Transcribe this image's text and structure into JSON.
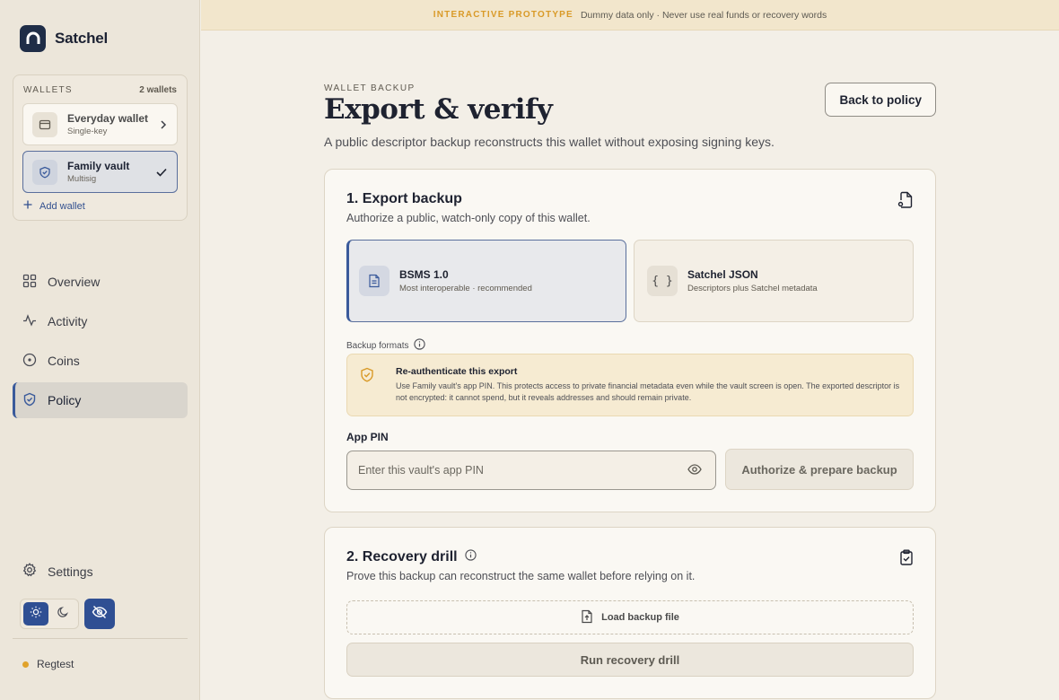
{
  "banner": {
    "tag": "INTERACTIVE PROTOTYPE",
    "text": "Dummy data only · Never use real funds or recovery words"
  },
  "brand": {
    "name": "Satchel",
    "logo_icon": "satchel-logo-icon"
  },
  "wallets": {
    "title": "WALLETS",
    "count": "2 wallets",
    "items": [
      {
        "name": "Everyday wallet",
        "type": "Single-key",
        "icon": "wallet-icon",
        "selected": false
      },
      {
        "name": "Family vault",
        "type": "Multisig",
        "icon": "shield-icon",
        "selected": true
      }
    ],
    "add_label": "Add wallet"
  },
  "nav": {
    "items": [
      {
        "label": "Overview",
        "icon": "grid-icon",
        "active": false
      },
      {
        "label": "Activity",
        "icon": "activity-icon",
        "active": false
      },
      {
        "label": "Coins",
        "icon": "coin-icon",
        "active": false
      },
      {
        "label": "Policy",
        "icon": "shield-icon",
        "active": true
      }
    ],
    "settings_label": "Settings"
  },
  "network": {
    "label": "Regtest",
    "dot_color": "#e0a22b"
  },
  "colors": {
    "accent": "#2f4f93",
    "warning": "#d99a28",
    "background": "#f3efe7"
  },
  "page": {
    "eyebrow": "WALLET BACKUP",
    "title": "Export & verify",
    "description": "A public descriptor backup reconstructs this wallet without exposing signing keys.",
    "back_label": "Back to policy"
  },
  "export": {
    "title": "1. Export backup",
    "description": "Authorize a public, watch-only copy of this wallet.",
    "formats": [
      {
        "name": "BSMS 1.0",
        "sub": "Most interoperable · recommended",
        "icon": "document-icon",
        "selected": true
      },
      {
        "name": "Satchel JSON",
        "sub": "Descriptors plus Satchel metadata",
        "icon": "braces-icon",
        "glyph": "{ }",
        "selected": false
      }
    ],
    "formats_label": "Backup formats",
    "notice": {
      "title": "Re-authenticate this export",
      "body": "Use Family vault's app PIN. This protects access to private financial metadata even while the vault screen is open. The exported descriptor is not encrypted: it cannot spend, but it reveals addresses and should remain private."
    },
    "pin_label": "App PIN",
    "pin_placeholder": "Enter this vault's app PIN",
    "pin_value": "",
    "authorize_label": "Authorize & prepare backup"
  },
  "drill": {
    "title": "2. Recovery drill",
    "description": "Prove this backup can reconstruct the same wallet before relying on it.",
    "load_label": "Load backup file",
    "run_label": "Run recovery drill"
  }
}
